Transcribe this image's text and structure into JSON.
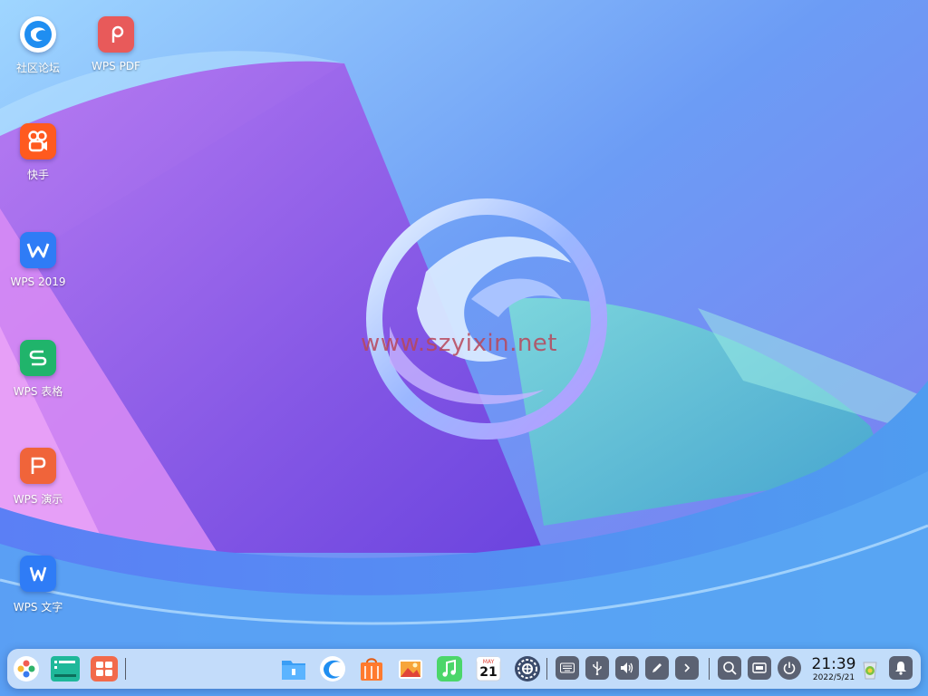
{
  "desktop": {
    "icons": [
      {
        "label": "社区论坛",
        "icon": "deepin-forum-icon"
      },
      {
        "label": "WPS PDF",
        "icon": "wps-pdf-icon"
      },
      {
        "label": "快手",
        "icon": "kuaishou-icon"
      },
      {
        "label": "WPS 2019",
        "icon": "wps-2019-icon"
      },
      {
        "label": "WPS 表格",
        "icon": "wps-spreadsheet-icon"
      },
      {
        "label": "WPS 演示",
        "icon": "wps-presentation-icon"
      },
      {
        "label": "WPS 文字",
        "icon": "wps-writer-icon"
      }
    ],
    "watermark": "www.szyixin.net"
  },
  "dock": {
    "left_apps": [
      "launcher-icon",
      "multitask-view-icon",
      "workspace-icon"
    ],
    "center_apps": [
      "file-manager-icon",
      "browser-icon",
      "app-store-icon",
      "image-viewer-icon",
      "music-icon",
      "calendar-icon",
      "control-center-icon"
    ],
    "calendar": {
      "month": "MAY",
      "day": "21"
    },
    "tray": [
      "keyboard-icon",
      "usb-icon",
      "volume-icon",
      "pen-icon",
      "expand-tray-icon"
    ],
    "right_tools": [
      "search-icon",
      "screen-icon",
      "power-icon"
    ],
    "clock": {
      "time": "21:39",
      "date": "2022/5/21"
    },
    "extra": [
      "trash-icon",
      "notification-bell-icon"
    ]
  },
  "colors": {
    "accent": "#3a7bf0",
    "wps_pdf": "#e85a5a",
    "kuaishou": "#ff5a1f",
    "wps_blue": "#2f7cf6",
    "wps_green": "#20b46b",
    "wps_orange": "#f0643a"
  }
}
